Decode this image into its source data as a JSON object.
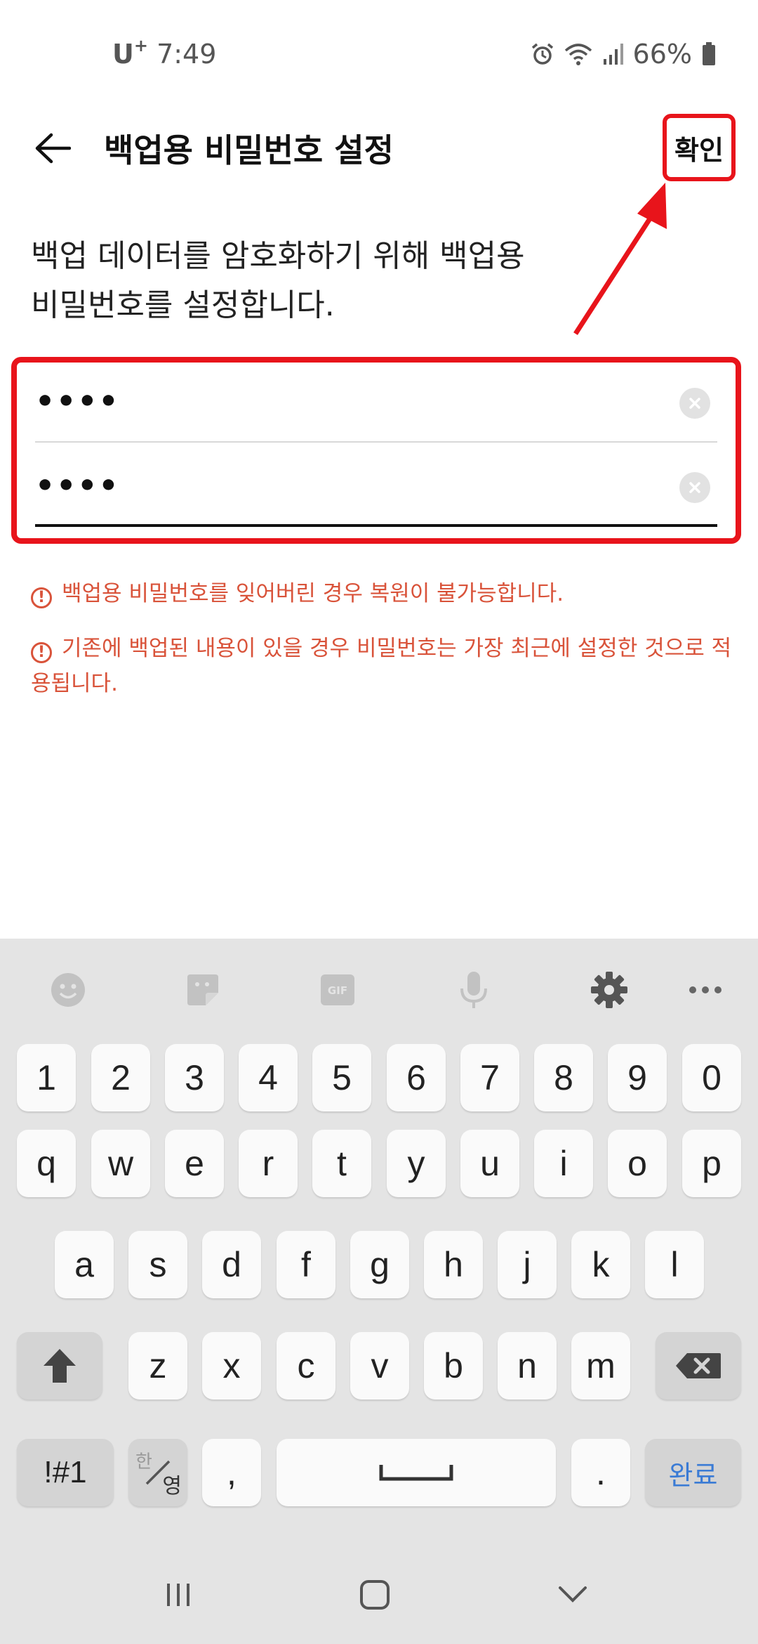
{
  "status_bar": {
    "carrier": "U",
    "carrier_sup": "+",
    "time": "7:49",
    "battery": "66%"
  },
  "app_bar": {
    "title": "백업용 비밀번호 설정",
    "confirm_label": "확인"
  },
  "description": {
    "line1": "백업 데이터를 암호화하기 위해 백업용",
    "line2": "비밀번호를 설정합니다."
  },
  "password": {
    "field1_value": "••••",
    "field2_value": "••••"
  },
  "warnings": [
    "백업용 비밀번호를 잊어버린 경우 복원이 불가능합니다.",
    "기존에 백업된 내용이 있을 경우 비밀번호는 가장 최근에 설정한 것으로 적용됩니다."
  ],
  "keyboard": {
    "number_row": [
      "1",
      "2",
      "3",
      "4",
      "5",
      "6",
      "7",
      "8",
      "9",
      "0"
    ],
    "row1": [
      "q",
      "w",
      "e",
      "r",
      "t",
      "y",
      "u",
      "i",
      "o",
      "p"
    ],
    "row2": [
      "a",
      "s",
      "d",
      "f",
      "g",
      "h",
      "j",
      "k",
      "l"
    ],
    "row3": [
      "z",
      "x",
      "c",
      "v",
      "b",
      "n",
      "m"
    ],
    "symbols_label": "!#1",
    "lang_top": "한",
    "lang_bottom": "영",
    "comma": ",",
    "period": ".",
    "done_label": "완료",
    "toolbar_icons": [
      "emoji-icon",
      "sticker-icon",
      "gif-icon",
      "mic-icon",
      "settings-icon",
      "more-icon"
    ]
  },
  "colors": {
    "annotation": "#e8141b",
    "warning": "#d9533a",
    "done": "#3a7bd5"
  }
}
